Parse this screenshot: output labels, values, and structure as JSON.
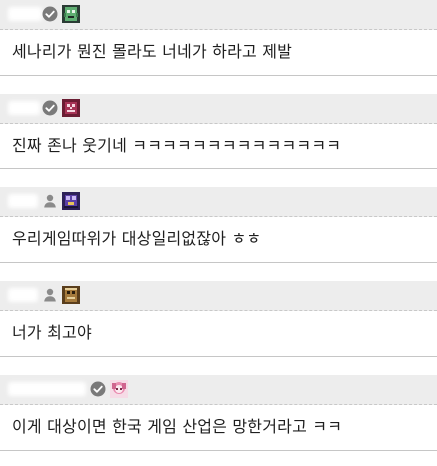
{
  "comments": [
    {
      "badge": "verified-check-icon",
      "avatar": "pixel-avatar-green-icon",
      "text": "세나리가 뭔진 몰라도 너네가 하라고 제발"
    },
    {
      "badge": "verified-check-icon",
      "avatar": "pixel-avatar-maroon-icon",
      "text": "진짜 존나 웃기네 ㅋㅋㅋㅋㅋㅋㅋㅋㅋㅋㅋㅋㅋㅋ"
    },
    {
      "badge": "user-icon",
      "avatar": "pixel-avatar-purple-icon",
      "text": "우리게임따위가 대상일리없잖아 ㅎㅎ"
    },
    {
      "badge": "user-icon",
      "avatar": "pixel-avatar-brown-icon",
      "text": "너가 최고야"
    },
    {
      "badge": "verified-check-icon",
      "avatar": "pixel-avatar-pink-icon",
      "text": "이게 대상이면 한국 게임 산업은 망한거라고 ㅋㅋ"
    }
  ],
  "colors": {
    "header_bg": "#ededed",
    "badge_gray": "#7a7a7a",
    "divider": "#c6c6c6",
    "text": "#1e1e1e"
  }
}
